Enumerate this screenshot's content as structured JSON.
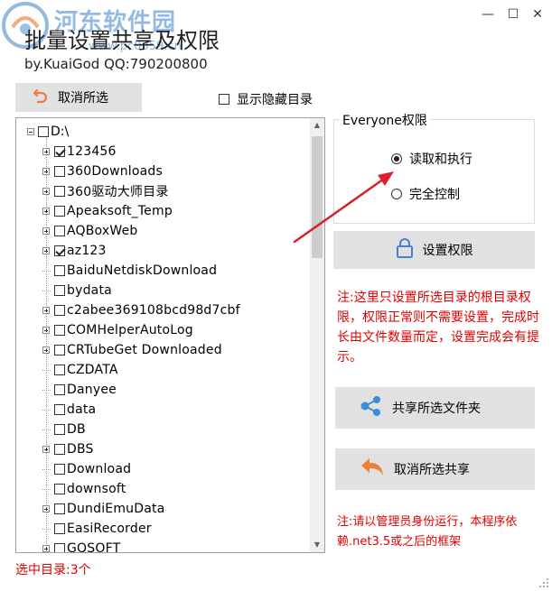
{
  "watermark": {
    "site_name": "河东软件园",
    "url": "www.pc0359.cn"
  },
  "window": {
    "title": "批量设置共享及权限",
    "subtitle": "by.KuaiGod  QQ:790200800",
    "minimize_glyph": "—",
    "maximize_glyph": "☐",
    "close_glyph": "✕"
  },
  "toolbar": {
    "cancel_selection_label": "取消所选",
    "show_hidden_label": "显示隐藏目录",
    "show_hidden_checked": false
  },
  "tree": {
    "root": "D:\\",
    "items": [
      {
        "name": "123456",
        "expandable": true,
        "checked": true
      },
      {
        "name": "360Downloads",
        "expandable": true,
        "checked": false
      },
      {
        "name": "360驱动大师目录",
        "expandable": true,
        "checked": false
      },
      {
        "name": "Apeaksoft_Temp",
        "expandable": true,
        "checked": false
      },
      {
        "name": "AQBoxWeb",
        "expandable": true,
        "checked": false
      },
      {
        "name": "az123",
        "expandable": true,
        "checked": true
      },
      {
        "name": "BaiduNetdiskDownload",
        "expandable": false,
        "checked": false
      },
      {
        "name": "bydata",
        "expandable": false,
        "checked": false
      },
      {
        "name": "c2abee369108bcd98d7cbf",
        "expandable": true,
        "checked": false
      },
      {
        "name": "COMHelperAutoLog",
        "expandable": true,
        "checked": false
      },
      {
        "name": "CRTubeGet Downloaded",
        "expandable": true,
        "checked": false
      },
      {
        "name": "CZDATA",
        "expandable": false,
        "checked": false
      },
      {
        "name": "Danyee",
        "expandable": false,
        "checked": false
      },
      {
        "name": "data",
        "expandable": false,
        "checked": false
      },
      {
        "name": "DB",
        "expandable": false,
        "checked": false
      },
      {
        "name": "DBS",
        "expandable": true,
        "checked": false
      },
      {
        "name": "Download",
        "expandable": false,
        "checked": false
      },
      {
        "name": "downsoft",
        "expandable": false,
        "checked": false
      },
      {
        "name": "DundiEmuData",
        "expandable": true,
        "checked": false
      },
      {
        "name": "EasiRecorder",
        "expandable": false,
        "checked": false
      },
      {
        "name": "GQSOFT",
        "expandable": true,
        "checked": false
      }
    ],
    "scroll_up_glyph": "▲",
    "scroll_down_glyph": "▼"
  },
  "status": {
    "selected_count": "选中目录:3个"
  },
  "permissions": {
    "group_title": "Everyone权限",
    "options": [
      {
        "label": "读取和执行",
        "selected": true
      },
      {
        "label": "完全控制",
        "selected": false
      }
    ],
    "set_button_label": "设置权限",
    "note": "注:这里只设置所选目录的根目录权限，权限正常则不需要设置，完成时长由文件数量而定，设置完成会有提示。"
  },
  "sharing": {
    "share_button_label": "共享所选文件夹",
    "unshare_button_label": "取消所选共享",
    "note": "注:请以管理员身份运行，本程序依赖.net3.5或之后的框架"
  },
  "colors": {
    "accent_red": "#e00000",
    "button_bg": "#e1e1e1",
    "undo_icon": "#f07d3a",
    "share_icon": "#3a8fd8",
    "lock_icon": "#4a7fd6",
    "annotation_arrow": "#d9202a"
  },
  "icons": {
    "cancel_selection": "undo-icon",
    "set_permission": "lock-icon",
    "share": "share-icon",
    "unshare": "reply-icon"
  }
}
